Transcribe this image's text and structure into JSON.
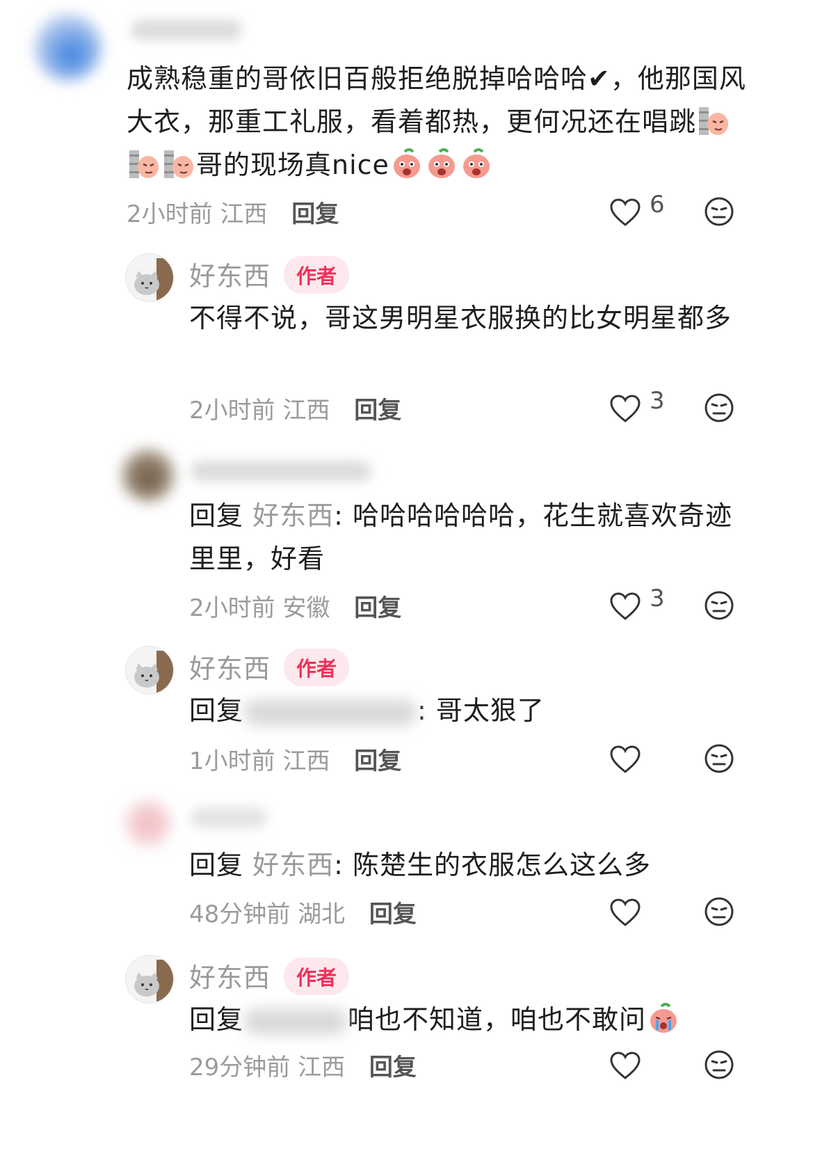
{
  "comments": [
    {
      "text_parts": [
        "成熟稳重的哥依旧百般拒绝脱掉哈哈哈",
        "✔",
        "，他那国风大衣，那重工礼服，看着都热，更何况还在唱跳",
        "哥的现场真nice"
      ],
      "time": "2小时前",
      "location": "江西",
      "reply_label": "回复",
      "likes": "6"
    },
    {
      "author": "好东西",
      "badge": "作者",
      "text": "不得不说，哥这男明星衣服换的比女明星都多",
      "time": "2小时前",
      "location": "江西",
      "reply_label": "回复",
      "likes": "3"
    },
    {
      "prefix": "回复",
      "target": "好东西",
      "colon": ":",
      "text": "哈哈哈哈哈哈，花生就喜欢奇迹里里，好看",
      "time": "2小时前",
      "location": "安徽",
      "reply_label": "回复",
      "likes": "3"
    },
    {
      "author": "好东西",
      "badge": "作者",
      "prefix": "回复",
      "text": ": 哥太狠了",
      "time": "1小时前",
      "location": "江西",
      "reply_label": "回复"
    },
    {
      "prefix": "回复",
      "target": "好东西",
      "colon": ":",
      "text": "陈楚生的衣服怎么这么多",
      "time": "48分钟前",
      "location": "湖北",
      "reply_label": "回复"
    },
    {
      "author": "好东西",
      "badge": "作者",
      "prefix": "回复",
      "text": "咱也不知道，咱也不敢问",
      "time": "29分钟前",
      "location": "江西",
      "reply_label": "回复"
    }
  ],
  "colors": {
    "badge_text": "#ee3159",
    "badge_bg": "#fde8ed",
    "secondary_text": "#9b9b9b"
  },
  "icons": [
    "heart-icon",
    "dislike-face-icon",
    "peach-emoji",
    "wall-emoji",
    "crying-emoji"
  ]
}
